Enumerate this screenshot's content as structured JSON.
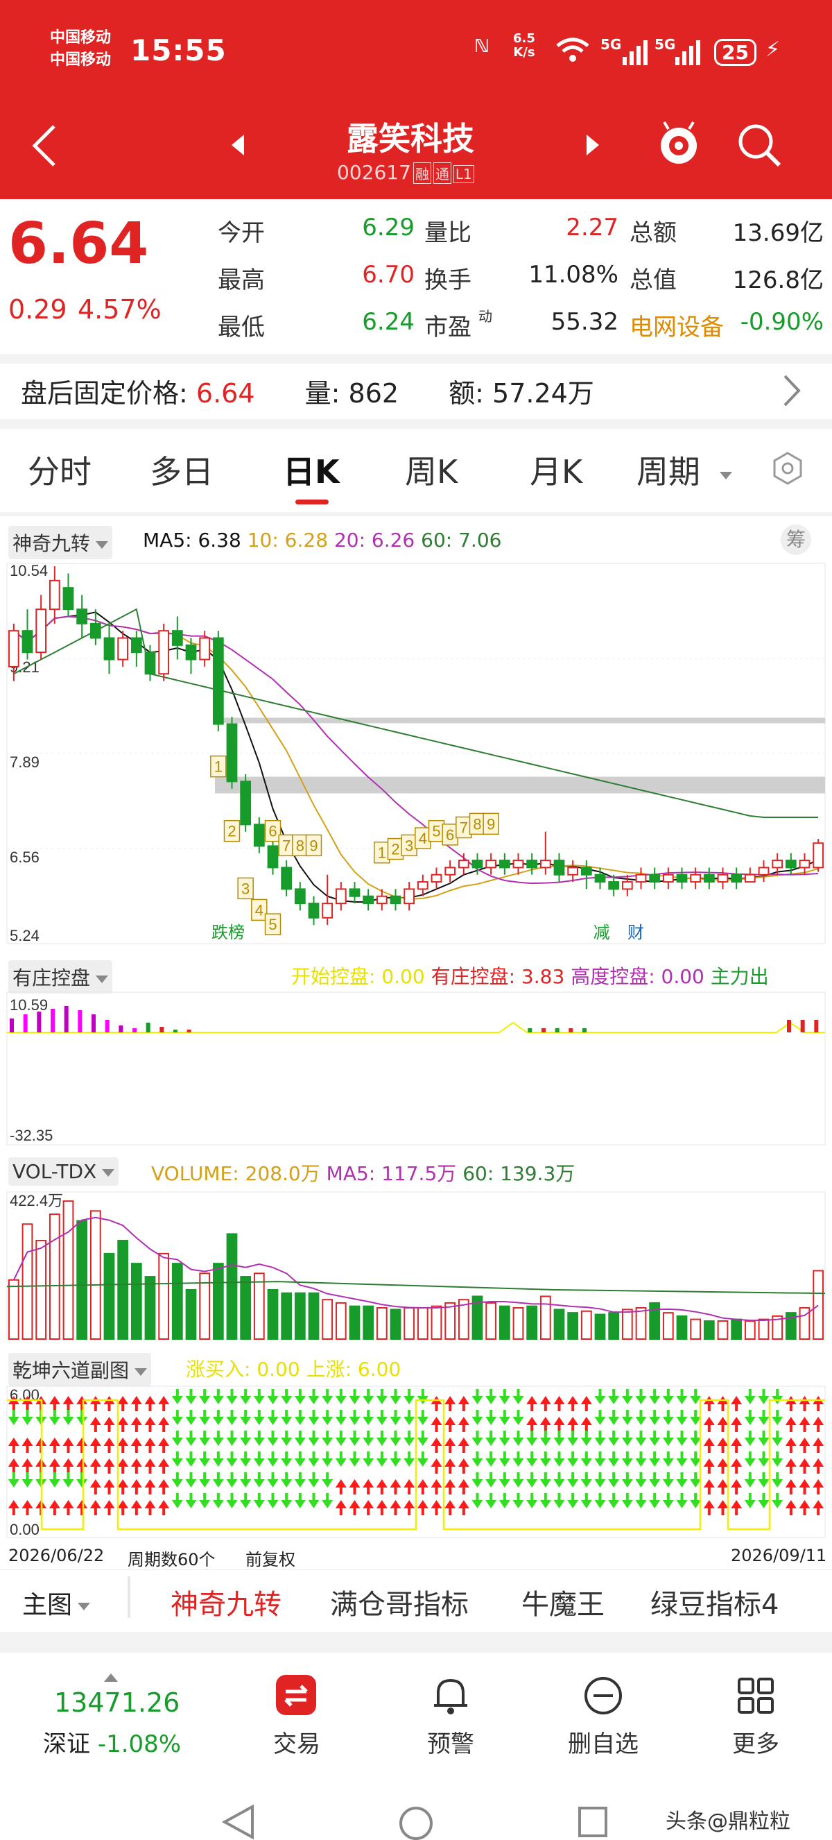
{
  "status_bar": {
    "carrier1": "中国移动",
    "carrier2": "中国移动",
    "time": "15:55",
    "net_speed_top": "6.5",
    "net_speed_bottom": "K/s",
    "signal1": "5G",
    "signal2": "5G",
    "battery": "25"
  },
  "header": {
    "stock_name": "露笑科技",
    "stock_code": "002617",
    "tag1": "融",
    "tag2": "通",
    "tag3": "L1"
  },
  "quote": {
    "price": "6.64",
    "change": "0.29",
    "change_pct": "4.57%",
    "rows": [
      {
        "l1": "今开",
        "v1": "6.29",
        "c1": "green",
        "l2": "量比",
        "v2": "2.27",
        "c2": "red",
        "l3": "总额",
        "v3": "13.69亿",
        "c3": "black"
      },
      {
        "l1": "最高",
        "v1": "6.70",
        "c1": "red",
        "l2": "换手",
        "v2": "11.08%",
        "c2": "black",
        "l3": "总值",
        "v3": "126.8亿",
        "c3": "black"
      },
      {
        "l1": "最低",
        "v1": "6.24",
        "c1": "green",
        "l2": "市盈",
        "v2": "55.32",
        "c2": "black",
        "l3": "电网设备",
        "v3": "-0.90%",
        "c3": "green"
      }
    ],
    "pe_sup": "动"
  },
  "after_hours": {
    "label": "盘后固定价格:",
    "price": "6.64",
    "vol_label": "量:",
    "vol": "862",
    "amt_label": "额:",
    "amt": "57.24万"
  },
  "tabs": [
    "分时",
    "多日",
    "日K",
    "周K",
    "月K",
    "周期"
  ],
  "active_tab": "日K",
  "main_chart": {
    "indicator": "神奇九转",
    "ma5": "MA5: 6.38",
    "ma10": "10: 6.28",
    "ma20": "20: 6.26",
    "ma60": "60: 7.06",
    "chip_btn": "筹",
    "y_labels": [
      "10.54",
      "9.21",
      "7.89",
      "6.56",
      "5.24"
    ],
    "marker_fall": "跌榜",
    "marker_reduce": "减",
    "marker_fin": "财",
    "colors": {
      "ma5": "#111111",
      "ma10": "#d4a017",
      "ma20": "#b030b0",
      "ma60": "#2e7d32",
      "up": "#e02424",
      "down": "#179b2b"
    }
  },
  "chart_data": {
    "type": "candlestick",
    "x_start": "2026/06/22",
    "x_end": "2026/09/11",
    "period_count": "周期数60个",
    "adjust": "前复权",
    "ylim": [
      5.24,
      10.54
    ],
    "candles": [
      [
        9.1,
        9.6,
        8.9,
        9.7
      ],
      [
        9.6,
        9.3,
        9.2,
        9.9
      ],
      [
        9.3,
        9.9,
        9.2,
        10.1
      ],
      [
        9.9,
        10.3,
        9.7,
        10.5
      ],
      [
        10.2,
        9.9,
        9.8,
        10.4
      ],
      [
        9.9,
        9.7,
        9.5,
        10.1
      ],
      [
        9.7,
        9.5,
        9.4,
        9.9
      ],
      [
        9.5,
        9.2,
        9.0,
        9.7
      ],
      [
        9.2,
        9.5,
        9.1,
        9.6
      ],
      [
        9.5,
        9.3,
        9.1,
        9.6
      ],
      [
        9.3,
        9.0,
        8.9,
        9.4
      ],
      [
        9.0,
        9.6,
        8.9,
        9.7
      ],
      [
        9.6,
        9.4,
        9.2,
        9.8
      ],
      [
        9.4,
        9.2,
        9.0,
        9.5
      ],
      [
        9.2,
        9.5,
        9.1,
        9.6
      ],
      [
        9.5,
        8.3,
        8.2,
        9.6
      ],
      [
        8.3,
        7.5,
        7.4,
        8.4
      ],
      [
        7.5,
        6.9,
        6.8,
        7.6
      ],
      [
        6.9,
        6.6,
        6.5,
        7.0
      ],
      [
        6.6,
        6.3,
        6.2,
        6.7
      ],
      [
        6.3,
        6.0,
        5.9,
        6.4
      ],
      [
        6.0,
        5.8,
        5.7,
        6.1
      ],
      [
        5.8,
        5.6,
        5.5,
        5.9
      ],
      [
        5.6,
        5.8,
        5.5,
        6.2
      ],
      [
        5.8,
        6.0,
        5.7,
        6.1
      ],
      [
        6.0,
        5.9,
        5.8,
        6.1
      ],
      [
        5.9,
        5.8,
        5.7,
        6.0
      ],
      [
        5.8,
        5.9,
        5.7,
        6.0
      ],
      [
        5.9,
        5.8,
        5.7,
        6.0
      ],
      [
        5.8,
        6.0,
        5.7,
        6.1
      ],
      [
        6.0,
        6.1,
        5.9,
        6.2
      ],
      [
        6.1,
        6.2,
        6.0,
        6.3
      ],
      [
        6.2,
        6.3,
        6.1,
        6.4
      ],
      [
        6.3,
        6.4,
        6.2,
        6.5
      ],
      [
        6.4,
        6.3,
        6.2,
        6.5
      ],
      [
        6.3,
        6.4,
        6.2,
        6.5
      ],
      [
        6.4,
        6.3,
        6.2,
        6.5
      ],
      [
        6.3,
        6.4,
        6.2,
        6.5
      ],
      [
        6.4,
        6.3,
        6.2,
        6.5
      ],
      [
        6.3,
        6.4,
        6.2,
        6.8
      ],
      [
        6.4,
        6.2,
        6.1,
        6.5
      ],
      [
        6.2,
        6.3,
        6.1,
        6.4
      ],
      [
        6.3,
        6.2,
        6.0,
        6.4
      ],
      [
        6.2,
        6.1,
        6.0,
        6.3
      ],
      [
        6.1,
        6.0,
        5.9,
        6.2
      ],
      [
        6.0,
        6.1,
        5.9,
        6.2
      ],
      [
        6.1,
        6.2,
        6.0,
        6.3
      ],
      [
        6.2,
        6.1,
        6.0,
        6.3
      ],
      [
        6.1,
        6.2,
        6.0,
        6.3
      ],
      [
        6.2,
        6.1,
        6.0,
        6.3
      ],
      [
        6.1,
        6.2,
        6.0,
        6.3
      ],
      [
        6.2,
        6.1,
        6.0,
        6.3
      ],
      [
        6.1,
        6.2,
        6.0,
        6.3
      ],
      [
        6.2,
        6.1,
        6.0,
        6.3
      ],
      [
        6.1,
        6.2,
        6.1,
        6.3
      ],
      [
        6.2,
        6.3,
        6.1,
        6.4
      ],
      [
        6.3,
        6.4,
        6.2,
        6.5
      ],
      [
        6.4,
        6.3,
        6.2,
        6.5
      ],
      [
        6.3,
        6.4,
        6.2,
        6.5
      ],
      [
        6.3,
        6.64,
        6.24,
        6.7
      ]
    ],
    "nine_buy": [
      "1",
      "2",
      "3",
      "4",
      "5"
    ],
    "nine_sell_a": [
      "6",
      "7",
      "8",
      "9"
    ],
    "nine_sell_b": [
      "1",
      "2",
      "3",
      "4",
      "5",
      "6",
      "7",
      "8",
      "9"
    ]
  },
  "control_panel": {
    "indicator": "有庄控盘",
    "start_label": "开始控盘: 0.00",
    "has_label": "有庄控盘: 3.83",
    "high_label": "高度控盘: 0.00",
    "main_out": "主力出",
    "y_top": "10.59",
    "y_bottom": "-32.35"
  },
  "volume_panel": {
    "indicator": "VOL-TDX",
    "volume": "VOLUME: 208.0万",
    "ma5": "MA5: 117.5万",
    "ma60": "60: 139.3万",
    "y_top": "422.4万",
    "bars": [
      180,
      350,
      300,
      380,
      420,
      360,
      390,
      260,
      300,
      230,
      190,
      260,
      230,
      150,
      200,
      230,
      320,
      190,
      200,
      150,
      140,
      140,
      140,
      120,
      110,
      100,
      100,
      95,
      90,
      95,
      95,
      100,
      110,
      120,
      130,
      110,
      100,
      95,
      100,
      130,
      90,
      80,
      85,
      75,
      80,
      90,
      95,
      110,
      80,
      70,
      60,
      55,
      55,
      60,
      55,
      60,
      70,
      80,
      95,
      208
    ],
    "bar_up": [
      1,
      1,
      1,
      1,
      1,
      0,
      1,
      0,
      0,
      0,
      0,
      1,
      0,
      0,
      1,
      0,
      0,
      0,
      1,
      0,
      0,
      0,
      0,
      1,
      1,
      0,
      0,
      1,
      0,
      1,
      1,
      1,
      1,
      1,
      0,
      1,
      0,
      1,
      0,
      1,
      0,
      0,
      1,
      0,
      0,
      1,
      1,
      0,
      1,
      0,
      1,
      0,
      1,
      0,
      1,
      1,
      1,
      0,
      1,
      1
    ]
  },
  "qiankun_panel": {
    "indicator": "乾坤六道副图",
    "buy_label": "涨买入: 0.00",
    "up_label": "上涨: 6.00",
    "y_top": "6.00",
    "y_bottom": "0.00"
  },
  "x_axis": {
    "start": "2026/06/22",
    "count": "周期数60个",
    "adjust": "前复权",
    "end": "2026/09/11"
  },
  "bottom_tabs": {
    "main": "主图",
    "items": [
      "神奇九转",
      "满仓哥指标",
      "牛魔王",
      "绿豆指标4"
    ],
    "active": "神奇九转"
  },
  "bottom_nav": {
    "index_value": "13471.26",
    "index_name": "深证",
    "index_change": "-1.08%",
    "items": [
      "交易",
      "预警",
      "删自选",
      "更多"
    ]
  },
  "watermark": "头条@鼎粒粒"
}
